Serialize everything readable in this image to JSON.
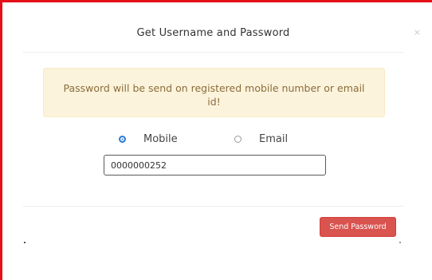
{
  "dialog": {
    "title": "Get Username and Password",
    "close_glyph": "×"
  },
  "alert": {
    "message": "Password will be send on registered mobile number or email id!",
    "bg_color": "#fcf3dc",
    "text_color": "#8a6d3b"
  },
  "delivery_options": [
    {
      "label": "Mobile",
      "checked": true
    },
    {
      "label": "Email",
      "checked": false
    }
  ],
  "mobile_input": {
    "value": "0000000252"
  },
  "footer": {
    "send_label": "Send Password",
    "send_color": "#d9534f"
  },
  "frame_color": "#e3101a",
  "accent_color": "#2f7ad8"
}
